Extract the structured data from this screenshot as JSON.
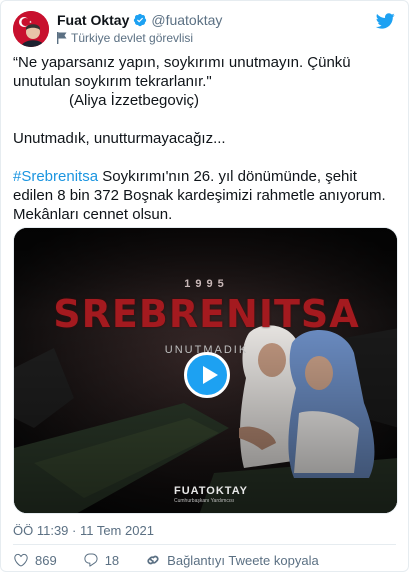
{
  "author": {
    "display_name": "Fuat Oktay",
    "handle": "@fuatoktay",
    "label": "Türkiye devlet görevlisi"
  },
  "tweet": {
    "line1": "“Ne yaparsanız yapın, soykırımı unutmayın. Çünkü",
    "line2": "unutulan soykırım tekrarlanır.\"",
    "line3": "(Aliya İzzetbegoviç)",
    "line4": "Unutmadık, unutturmayacağız...",
    "hashtag": "#Srebrenitsa",
    "line5_rest": " Soykırımı'nın 26. yıl dönümünde, şehit",
    "line6": "edilen 8 bin 372 Boşnak kardeşimizi rahmetle anıyorum.",
    "line7": "Mekânları cennet olsun."
  },
  "media": {
    "year": "1995",
    "headline": "SREBRENITSA",
    "subtitle": "UNUTMADIK",
    "brand": "FUATOKTAY",
    "brand_sub": "Cumhurbaşkanı Yardımcısı"
  },
  "timestamp": "ÖÖ 11:39 · 11 Tem 2021",
  "actions": {
    "likes": "869",
    "replies": "18",
    "copy_link": "Bağlantıyı Tweete kopyala"
  },
  "colors": {
    "accent": "#1da1f2",
    "hashtag": "#1b95e0",
    "like": "#e0245e",
    "muted": "#5b7083"
  }
}
